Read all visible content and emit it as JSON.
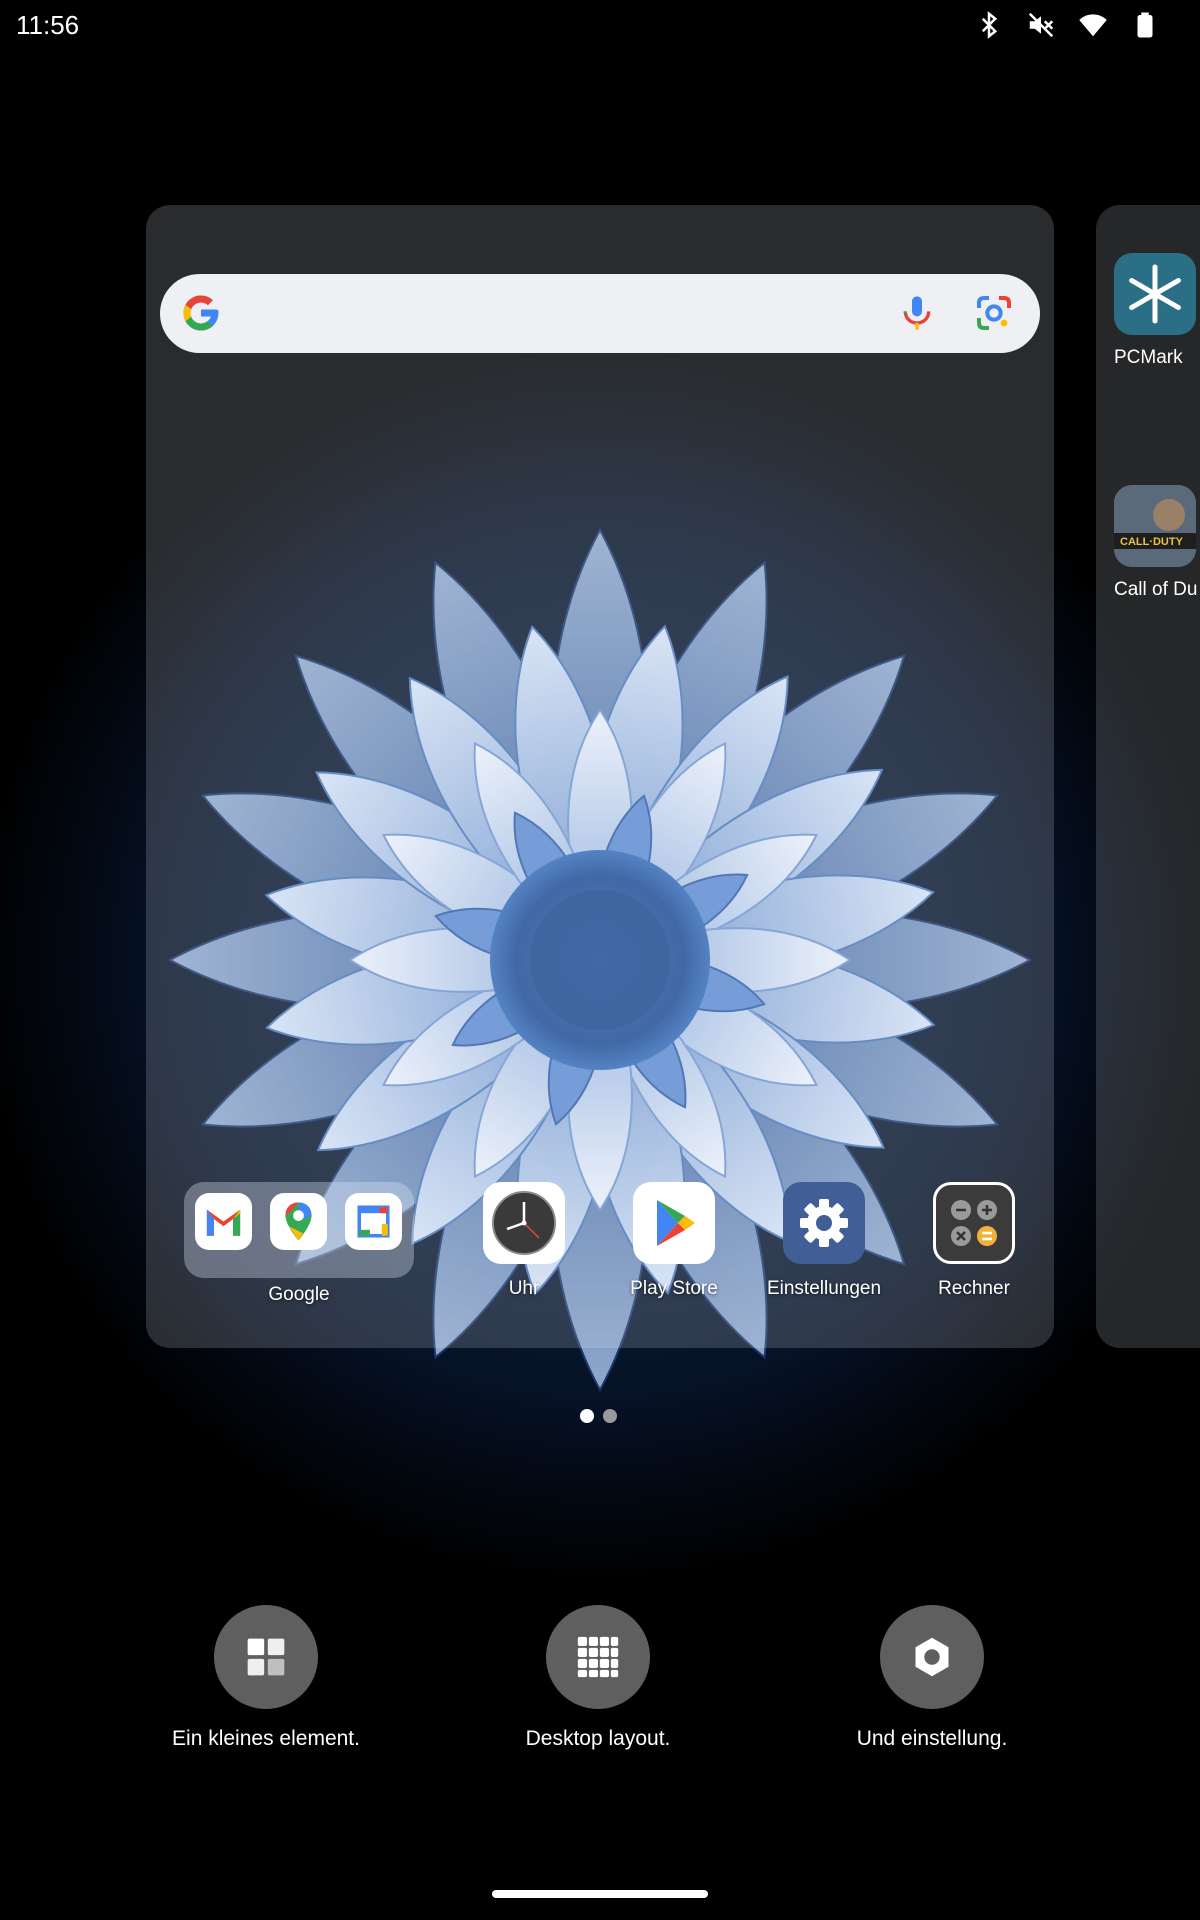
{
  "status_bar": {
    "time": "11:56",
    "icons": [
      "bluetooth-icon",
      "mute-icon",
      "wifi-icon",
      "battery-icon"
    ]
  },
  "search_bar": {
    "icons": [
      "google-logo",
      "mic-icon",
      "lens-icon"
    ]
  },
  "dock": {
    "folder_label": "Google",
    "folder_apps": [
      "gmail-icon",
      "maps-icon",
      "calendar-icon"
    ],
    "apps": [
      {
        "label": "Uhr",
        "icon": "clock-icon"
      },
      {
        "label": "Play Store",
        "icon": "play-store-icon"
      },
      {
        "label": "Einstellungen",
        "icon": "settings-icon"
      },
      {
        "label": "Rechner",
        "icon": "calculator-icon"
      }
    ]
  },
  "next_page_apps": [
    {
      "label": "PCMark",
      "icon": "pcmark-icon"
    },
    {
      "label": "Call of Du",
      "icon": "call-of-duty-icon"
    }
  ],
  "page_indicator": {
    "pages": 2,
    "current": 1
  },
  "edit_options": [
    {
      "label": "Ein kleines element.",
      "icon": "widgets-icon"
    },
    {
      "label": "Desktop layout.",
      "icon": "grid-icon"
    },
    {
      "label": "Und einstellung.",
      "icon": "settings-hex-icon"
    }
  ],
  "colors": {
    "background": "#000000",
    "panel": "rgba(235,240,250,0.18)",
    "google_blue": "#4285F4",
    "google_red": "#EA4335",
    "google_yellow": "#FBBC05",
    "google_green": "#34A853",
    "settings_blue": "#3f5f96",
    "edit_circle": "#5f5f5f"
  }
}
